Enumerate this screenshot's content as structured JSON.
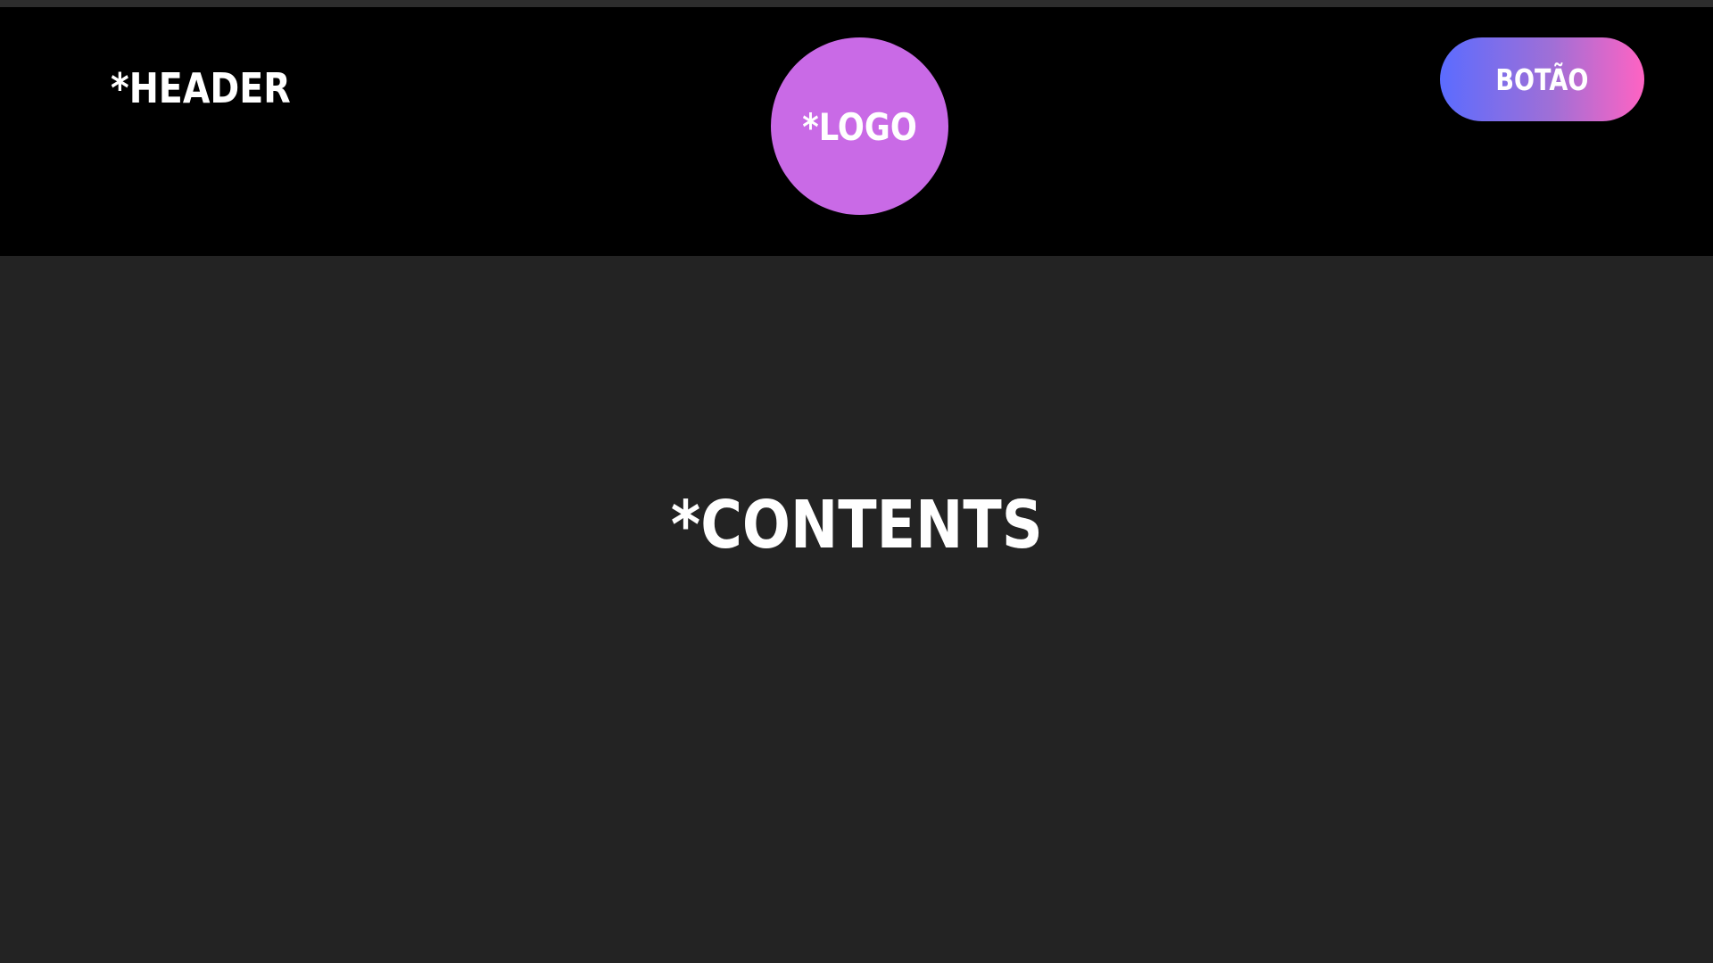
{
  "header": {
    "label": "*HEADER",
    "logo_label": "*LOGO",
    "button_label": "BOTÃO"
  },
  "main": {
    "label": "*CONTENTS"
  },
  "colors": {
    "header_background": "#000000",
    "page_background": "#232323",
    "logo_circle": "#c96ae6",
    "button_gradient_start": "#5b6cff",
    "button_gradient_end": "#ff63c3",
    "text": "#ffffff"
  }
}
